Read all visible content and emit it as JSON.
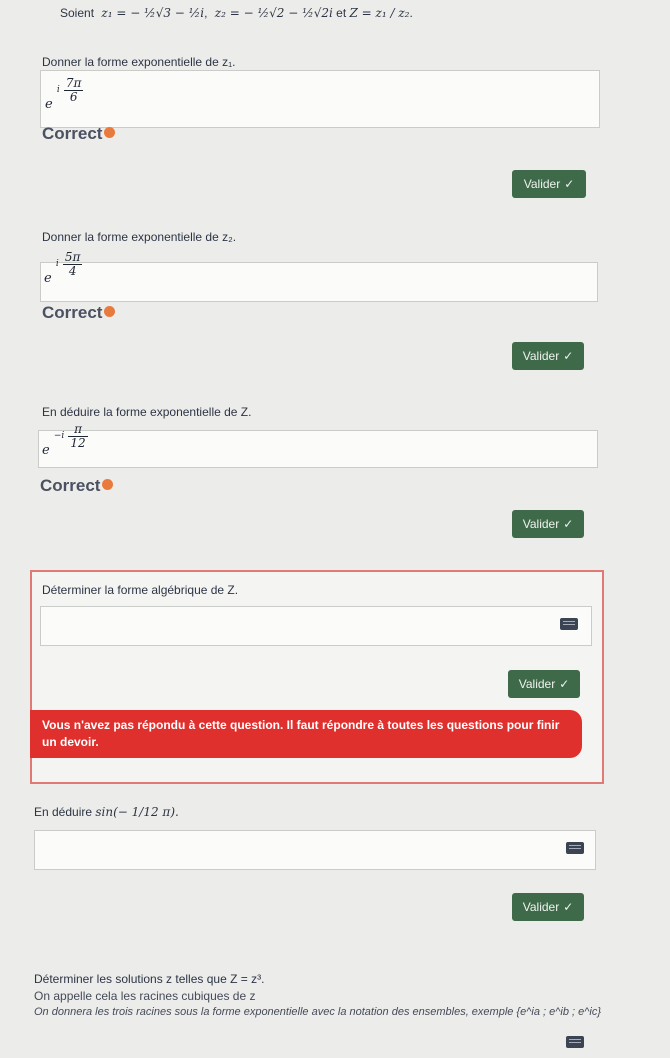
{
  "header": {
    "lead": "Soient",
    "z1_expr": "z₁ = − ½√3 − ½i",
    "z2_expr": "z₂ = − ½√2 − ½√2i",
    "z_link": "et",
    "Z_expr": "Z = z₁ / z₂"
  },
  "questions": [
    {
      "prompt": "Donner la forme exponentielle de z₁.",
      "answer_base": "e",
      "answer_num": "7π",
      "answer_den": "6",
      "answer_prefix": "i",
      "status": "Correct",
      "button": "Valider"
    },
    {
      "prompt": "Donner la forme exponentielle de z₂.",
      "answer_base": "e",
      "answer_num": "5π",
      "answer_den": "4",
      "answer_prefix": "i",
      "status": "Correct",
      "button": "Valider"
    },
    {
      "prompt": "En déduire la forme exponentielle de Z.",
      "answer_base": "e",
      "answer_num": "π",
      "answer_den": "12",
      "answer_prefix": "−i",
      "status": "Correct",
      "button": "Valider"
    },
    {
      "prompt": "Déterminer la forme algébrique de Z.",
      "button": "Valider",
      "error": "Vous n'avez pas répondu à cette question. Il faut répondre à toutes les questions pour finir un devoir."
    },
    {
      "prompt_lead": "En déduire",
      "prompt_expr": "sin(− 1/12 π).",
      "button": "Valider"
    }
  ],
  "last": {
    "line1": "Déterminer les solutions z telles que Z = z³.",
    "line2": "On appelle cela les racines cubiques de z",
    "line3": "On donnera les trois racines sous la forme exponentielle avec la notation des ensembles, exemple {e^ia ; e^ib ; e^ic}"
  },
  "colors": {
    "button": "#3f6a4a",
    "error": "#e0302e",
    "error_border": "#e07a76",
    "status_dot": "#e97a3d"
  }
}
